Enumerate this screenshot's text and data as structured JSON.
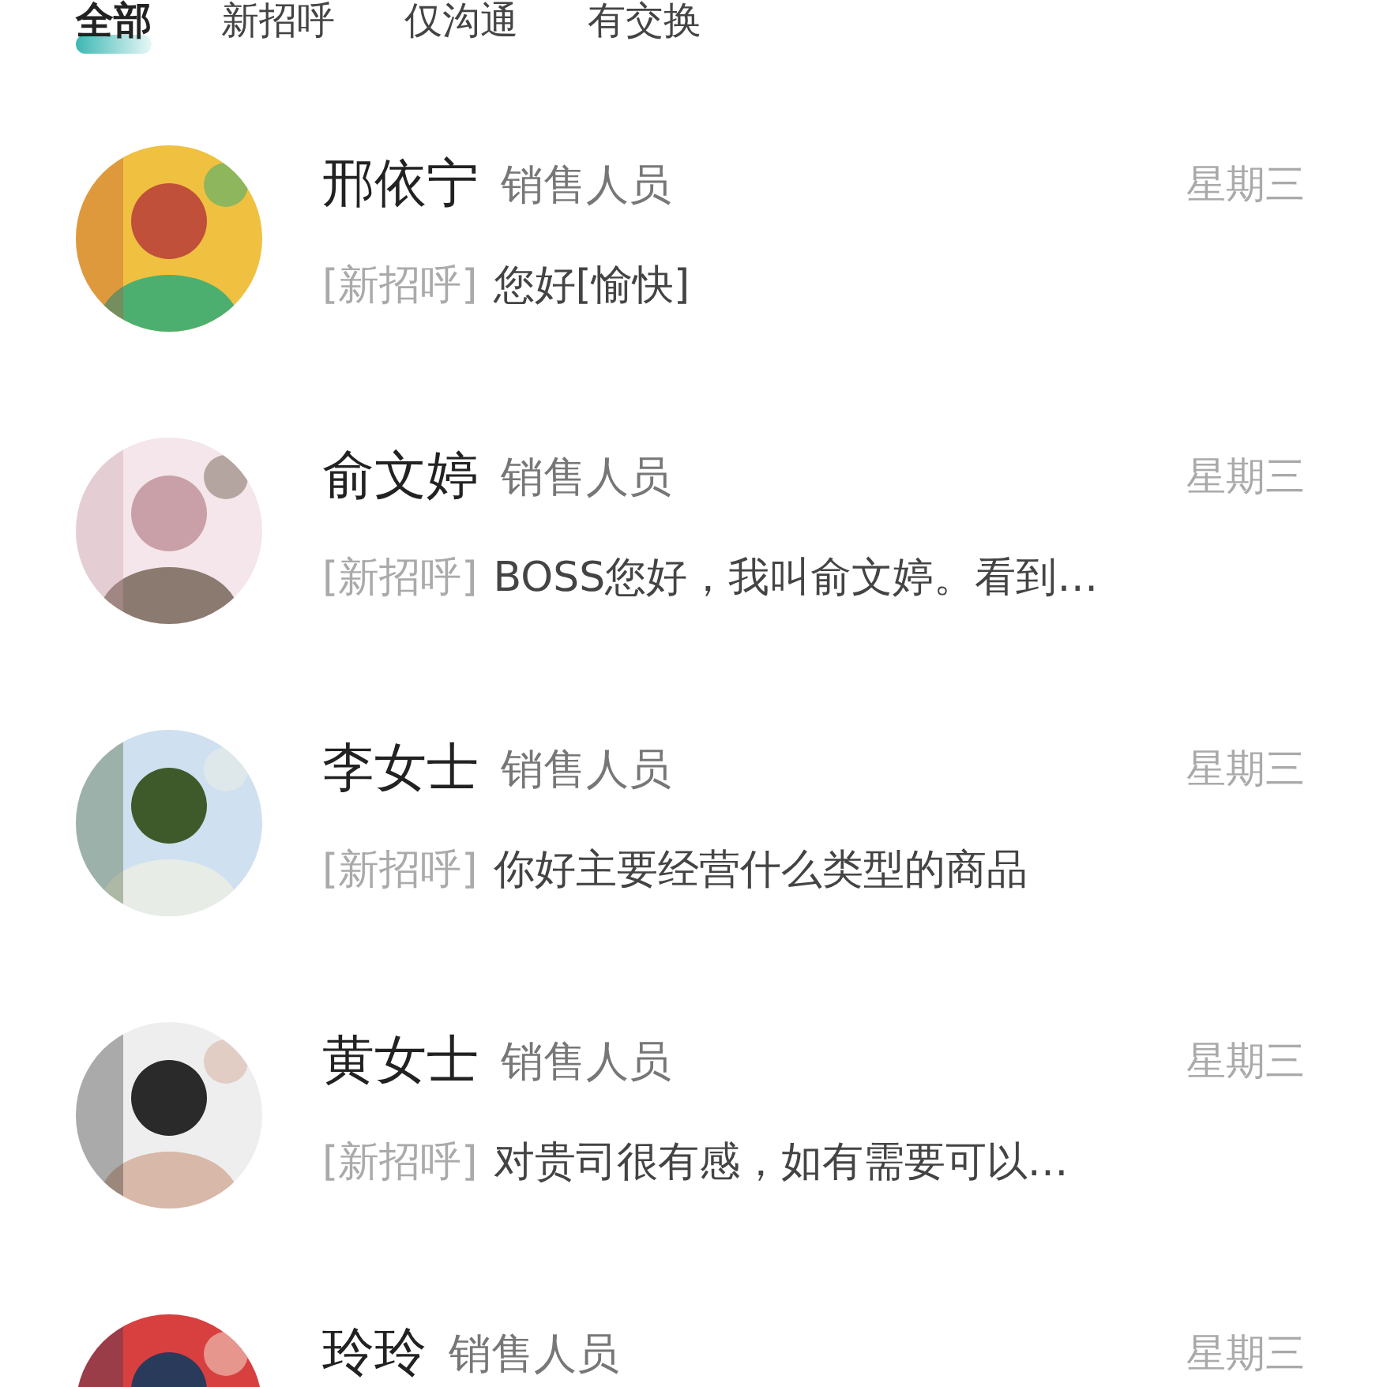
{
  "tabs": [
    {
      "label": "全部",
      "selected": true
    },
    {
      "label": "新招呼",
      "selected": false
    },
    {
      "label": "仅沟通",
      "selected": false
    },
    {
      "label": "有交换",
      "selected": false
    }
  ],
  "conversations": [
    {
      "name": "邢依宁",
      "role": "销售人员",
      "time": "星期三",
      "tag": "[新招呼]",
      "message": "您好[愉快]"
    },
    {
      "name": "俞文婷",
      "role": "销售人员",
      "time": "星期三",
      "tag": "[新招呼]",
      "message": "BOSS您好，我叫俞文婷。看到…"
    },
    {
      "name": "李女士",
      "role": "销售人员",
      "time": "星期三",
      "tag": "[新招呼]",
      "message": "你好主要经营什么类型的商品"
    },
    {
      "name": "黄女士",
      "role": "销售人员",
      "time": "星期三",
      "tag": "[新招呼]",
      "message": "对贵司很有感，如有需要可以…"
    },
    {
      "name": "玲玲",
      "role": "销售人员",
      "time": "星期三"
    }
  ]
}
